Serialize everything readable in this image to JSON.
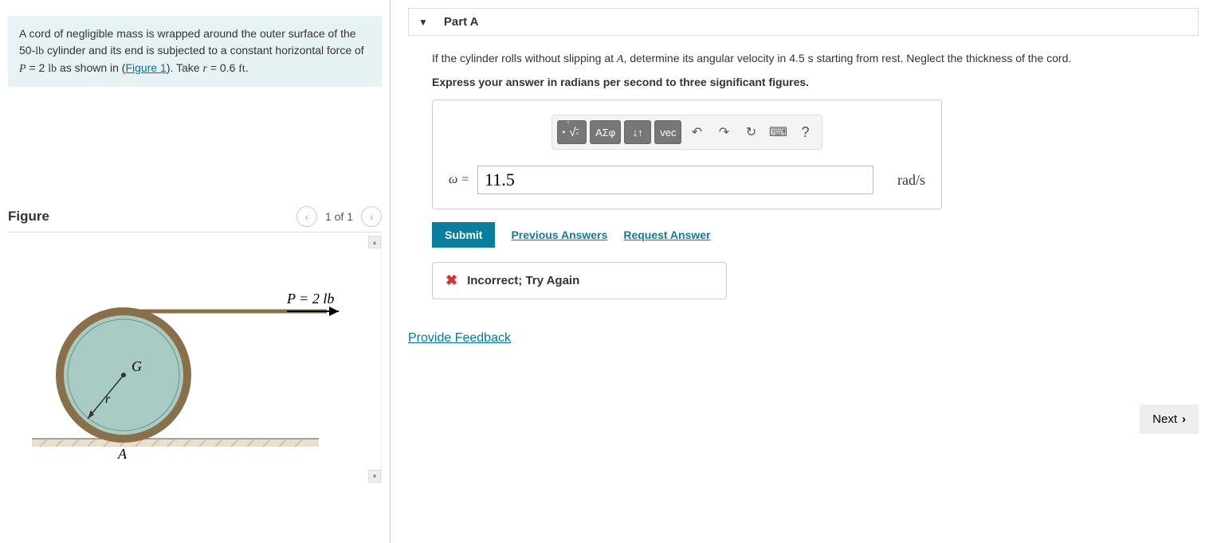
{
  "problem": {
    "line1a": "A cord of negligible mass is wrapped around the outer surface of the 50-",
    "lb1": "lb",
    "line1b": " cylinder and its end is subjected to a constant horizontal force of ",
    "Pvar": "P",
    "eq": " = 2 ",
    "lb2": "lb",
    "line1c": " as shown in (",
    "figlink": "Figure 1",
    "line1d": "). Take ",
    "rvar": "r",
    "rval": " = 0.6 ",
    "ft": "ft",
    "dot": "."
  },
  "figure": {
    "title": "Figure",
    "counter": "1 of 1",
    "p_label": "P = 2 lb",
    "g_label": "G",
    "r_label": "r",
    "a_label": "A"
  },
  "part": {
    "title": "Part A",
    "q1a": "If the cylinder rolls without slipping at ",
    "Avar": "A",
    "q1b": ", determine its angular velocity in 4.5 s starting from rest. Neglect the thickness of the cord.",
    "q2": "Express your answer in radians per second to three significant figures."
  },
  "toolbar": {
    "templates": "∎ √",
    "greek": "ΑΣφ",
    "subscript": "↓↑",
    "vec": "vec",
    "undo": "↶",
    "redo": "↷",
    "reset": "↻",
    "keyboard": "⌨",
    "help": "?"
  },
  "answer": {
    "label": "ω = ",
    "value": "11.5",
    "unit": "rad/s"
  },
  "actions": {
    "submit": "Submit",
    "previous": "Previous Answers",
    "request": "Request Answer"
  },
  "feedback": {
    "x": "✖",
    "text": "Incorrect; Try Again"
  },
  "footer": {
    "provide": "Provide Feedback",
    "next": "Next"
  }
}
